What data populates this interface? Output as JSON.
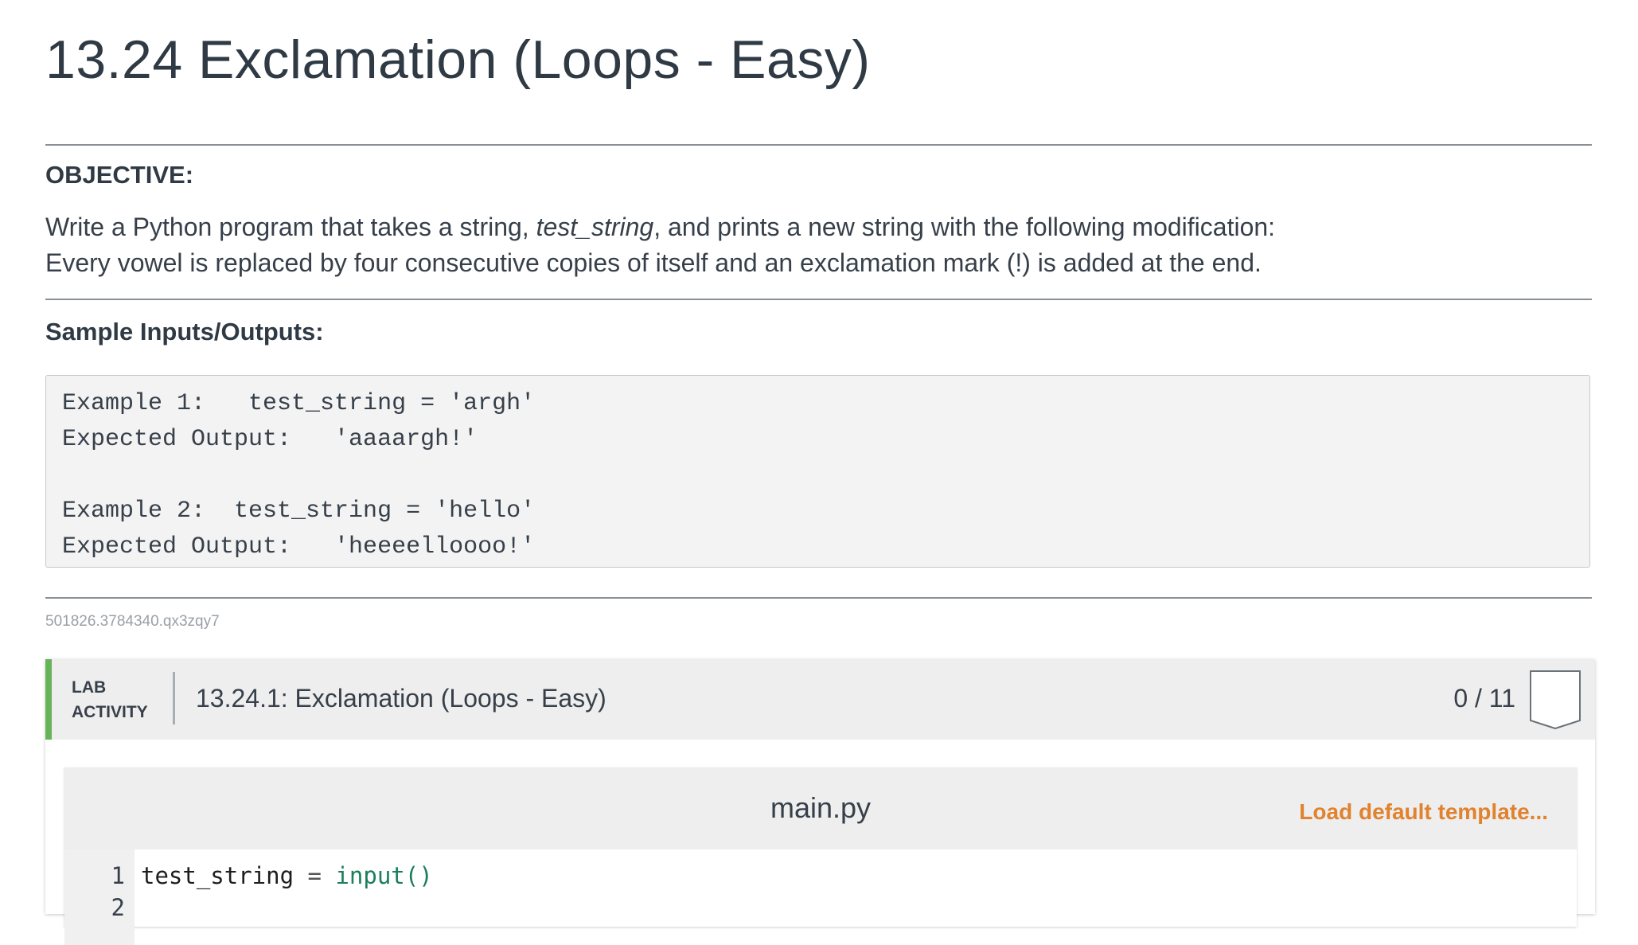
{
  "page": {
    "title": "13.24 Exclamation (Loops - Easy)"
  },
  "objective": {
    "heading": "OBJECTIVE:",
    "line1_pre": "Write a Python program that takes a string, ",
    "line1_var": "test_string",
    "line1_post": ", and prints a new string with the following modification:",
    "line2": "Every vowel is replaced by four consecutive copies of itself and an exclamation mark (!) is added at the end."
  },
  "samples": {
    "heading": "Sample Inputs/Outputs:",
    "lines": [
      "Example 1:   test_string = 'argh'",
      "Expected Output:   'aaaargh!'",
      "",
      "Example 2:  test_string = 'hello'",
      "Expected Output:   'heeeelloooo!'"
    ]
  },
  "lab": {
    "id": "501826.3784340.qx3zqy7",
    "label_line1": "LAB",
    "label_line2": "ACTIVITY",
    "title": "13.24.1: Exclamation (Loops - Easy)",
    "score": "0 / 11",
    "editor": {
      "filename": "main.py",
      "load_template_label": "Load default template...",
      "lines": [
        {
          "num": "1",
          "var": "test_string",
          "op": " = ",
          "fn": "input()"
        },
        {
          "num": "2",
          "var": "",
          "op": "",
          "fn": ""
        }
      ]
    }
  },
  "colors": {
    "accent_green": "#67b35a",
    "link_orange": "#e1822e",
    "text": "#37404a"
  }
}
